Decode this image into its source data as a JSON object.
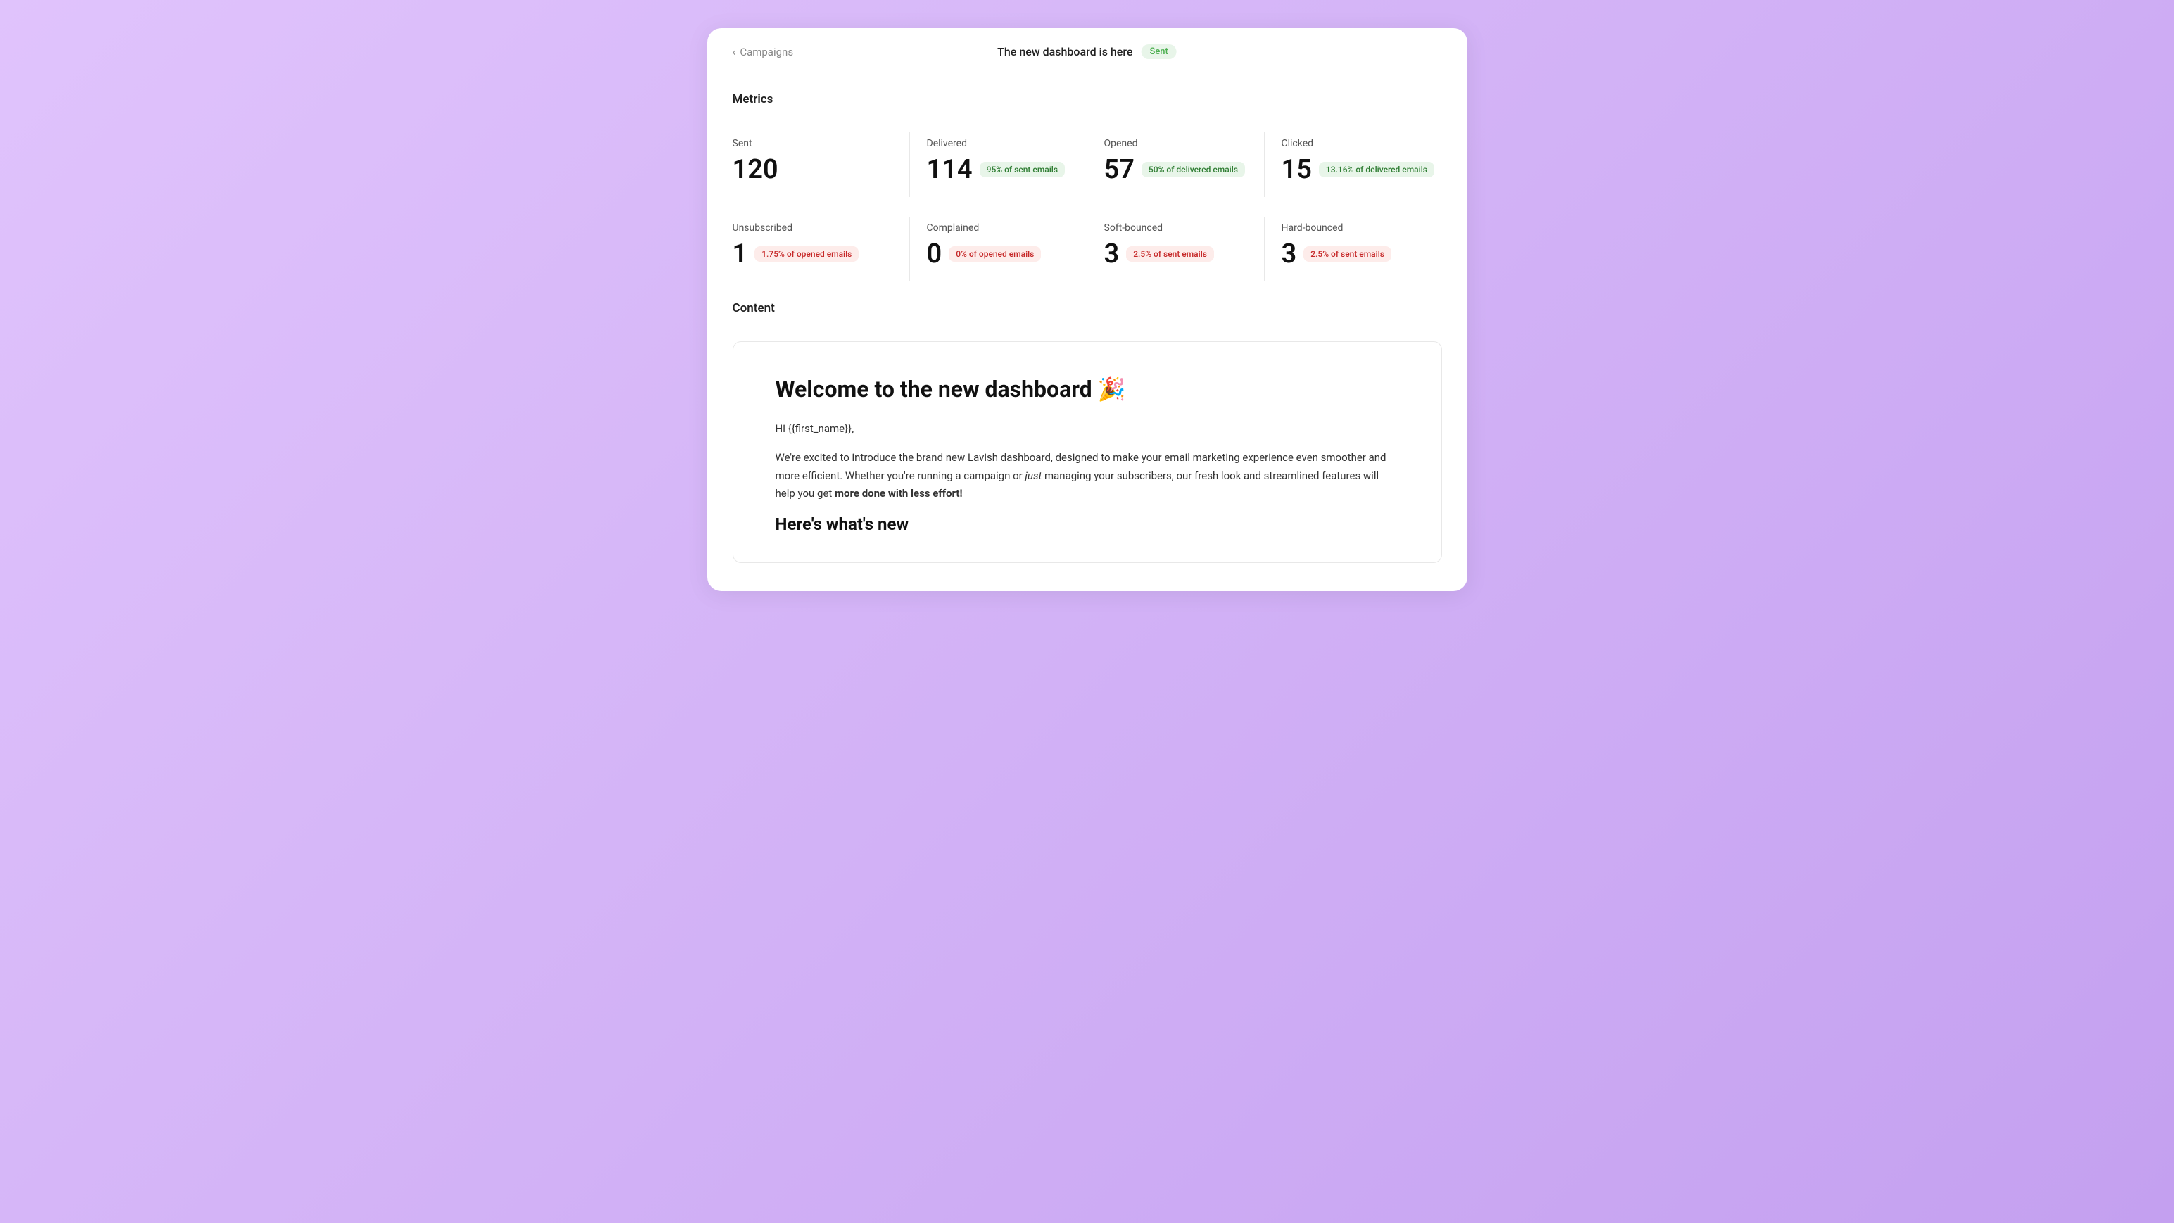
{
  "header": {
    "back_label": "Campaigns",
    "title": "The new dashboard is here",
    "status_badge": "Sent"
  },
  "metrics_section": {
    "title": "Metrics",
    "row1": [
      {
        "label": "Sent",
        "value": "120",
        "badge": null
      },
      {
        "label": "Delivered",
        "value": "114",
        "badge": "95% of sent emails",
        "badge_type": "green"
      },
      {
        "label": "Opened",
        "value": "57",
        "badge": "50% of delivered emails",
        "badge_type": "green"
      },
      {
        "label": "Clicked",
        "value": "15",
        "badge": "13.16% of delivered emails",
        "badge_type": "green"
      }
    ],
    "row2": [
      {
        "label": "Unsubscribed",
        "value": "1",
        "badge": "1.75% of opened emails",
        "badge_type": "red"
      },
      {
        "label": "Complained",
        "value": "0",
        "badge": "0% of opened emails",
        "badge_type": "red"
      },
      {
        "label": "Soft-bounced",
        "value": "3",
        "badge": "2.5% of sent emails",
        "badge_type": "red"
      },
      {
        "label": "Hard-bounced",
        "value": "3",
        "badge": "2.5% of sent emails",
        "badge_type": "red"
      }
    ]
  },
  "content_section": {
    "title": "Content",
    "email": {
      "heading": "Welcome to the new dashboard 🎉",
      "greeting": "Hi {{first_name}},",
      "body_paragraph": "We're excited to introduce the brand new Lavish dashboard, designed to make your email marketing experience even smoother and more efficient. Whether you're running a campaign or just managing your subscribers, our fresh look and streamlined features will help you get more done with less effort!",
      "body_italic_word": "just",
      "body_bold": "more done with less effort!",
      "sub_heading": "Here's what's new"
    }
  }
}
